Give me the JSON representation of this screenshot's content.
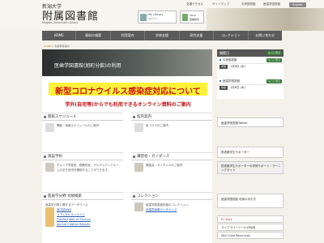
{
  "header": {
    "university": "新潟大学",
    "library_name": "附属図書館",
    "library_en": "Niigata University Library",
    "util_links": [
      "交通アクセス",
      "サイトマップ",
      "中央図書館",
      "医歯学図書館",
      "English"
    ],
    "mylibrary": {
      "title": "My Library",
      "sub": "ログイン"
    },
    "other": {
      "line1": "Other",
      "line2": "蔵書検索"
    }
  },
  "nav": {
    "items": [
      "HOME",
      "資料の検索",
      "利用案内",
      "学修支援",
      "研究支援",
      "コレクション",
      "お問い合わせ"
    ]
  },
  "breadcrumb": {
    "home": "HOME",
    "current": "利用学習案内"
  },
  "hero": {
    "title": "医歯学図書館(旭町分館)の利用"
  },
  "notice": {
    "covid": "新型コロナウイルス感染症対応について",
    "remote": "学外(自宅等)からでも利用できるオンライン資料のご案内"
  },
  "panels": {
    "schedule": {
      "title": "開館スケジュール",
      "body": "開館・休館スケジュールのご案内"
    },
    "guide": {
      "title": "館内案内",
      "body": "各フロアのご案内"
    },
    "facility": {
      "title": "施設予約",
      "body": "グループ学習室、視聴覚室、マルチメディアルームの空き状況を確認することができます。"
    },
    "seminar": {
      "title": "講習会・ガイダンス",
      "body": "講習会・ガイダンスのご案内"
    },
    "db": {
      "title": "医歯学分野 文献検索",
      "body": "医歯学分野に関するデータベース",
      "links": [
        "医中誌Web",
        "メディカルオンライン",
        "PubMed",
        "Web of Science",
        "Journal Citation Reports"
      ]
    },
    "collection": {
      "title": "コレクション",
      "body": "医歯学図書館所蔵のコレクション",
      "links": [
        "貴重書画像データベース"
      ]
    }
  },
  "side": {
    "hours_title": "開館日",
    "more": "もっと見る",
    "central": "中央図書館",
    "medical": "医歯学図書館",
    "days": [
      {
        "tag": "本館",
        "date": "1月6日 (水)"
      },
      {
        "tag": "本館",
        "date": "1月6日 (水)"
      }
    ],
    "banners": [
      "医歯学図書館Twitter",
      "図書館学生サポーター",
      "図書館学生サポーターの学修サポート・ラーニングガイド",
      "医歯学図書館 利用の手引き",
      "FL SALC",
      "ライブラリーツールの利用",
      "Site Cube Resources"
    ]
  }
}
